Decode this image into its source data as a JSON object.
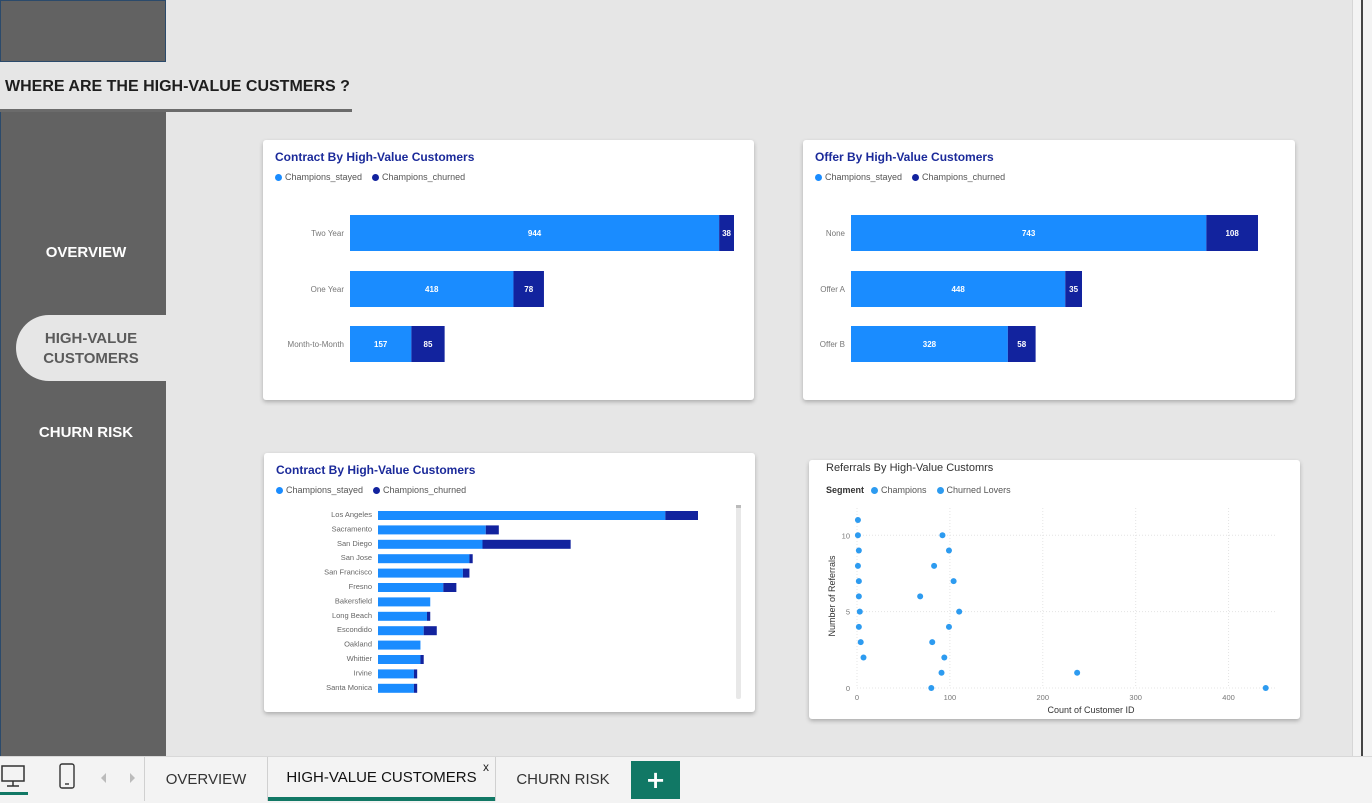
{
  "page": {
    "header": "WHERE ARE THE HIGH-VALUE CUSTMERS ?"
  },
  "nav": {
    "overview": "OVERVIEW",
    "high_value_line1": "HIGH-VALUE",
    "high_value_line2": "CUSTOMERS",
    "churn_risk": "CHURN RISK"
  },
  "colors": {
    "stayed": "#1a8cff",
    "churned": "#12239e",
    "accent": "#117865",
    "title": "#1b2a9a"
  },
  "legend": {
    "stayed": "Champions_stayed",
    "churned": "Champions_churned",
    "segment": "Segment",
    "champions": "Champions",
    "churned_lovers": "Churned Lovers"
  },
  "chart_data": [
    {
      "type": "bar",
      "orientation": "horizontal",
      "stacked": true,
      "title": "Contract By High-Value Customers",
      "categories": [
        "Two Year",
        "One Year",
        "Month-to-Month"
      ],
      "series": [
        {
          "name": "Champions_stayed",
          "values": [
            944,
            418,
            157
          ]
        },
        {
          "name": "Champions_churned",
          "values": [
            38,
            78,
            85
          ]
        }
      ],
      "data_labels": true,
      "legend": "top-left"
    },
    {
      "type": "bar",
      "orientation": "horizontal",
      "stacked": true,
      "title": "Offer By High-Value Customers",
      "categories": [
        "None",
        "Offer A",
        "Offer B"
      ],
      "series": [
        {
          "name": "Champions_stayed",
          "values": [
            743,
            448,
            328
          ]
        },
        {
          "name": "Champions_churned",
          "values": [
            108,
            35,
            58
          ]
        }
      ],
      "data_labels": true,
      "legend": "top-left"
    },
    {
      "type": "bar",
      "orientation": "horizontal",
      "stacked": true,
      "title": "Contract By High-Value Customers",
      "categories": [
        "Los Angeles",
        "Sacramento",
        "San Diego",
        "San Jose",
        "San Francisco",
        "Fresno",
        "Bakersfield",
        "Long Beach",
        "Escondido",
        "Oakland",
        "Whittier",
        "Irvine",
        "Santa Monica"
      ],
      "series": [
        {
          "name": "Champions_stayed",
          "values": [
            88,
            33,
            32,
            28,
            26,
            20,
            16,
            15,
            14,
            13,
            13,
            11,
            11
          ]
        },
        {
          "name": "Champions_churned",
          "values": [
            10,
            4,
            27,
            1,
            2,
            4,
            0,
            1,
            4,
            0,
            1,
            1,
            1
          ]
        }
      ],
      "data_labels": false,
      "legend": "top-left"
    },
    {
      "type": "scatter",
      "title": "Referrals By High-Value Customrs",
      "xlabel": "Count of Customer ID",
      "ylabel": "Number of Referrals",
      "xlim": [
        0,
        450
      ],
      "ylim": [
        0,
        11
      ],
      "xticks": [
        0,
        100,
        200,
        300,
        400
      ],
      "yticks": [
        0,
        5,
        10
      ],
      "grid": true,
      "series": [
        {
          "name": "Champions",
          "points": [
            [
              1,
              11
            ],
            [
              1,
              10
            ],
            [
              2,
              9
            ],
            [
              1,
              8
            ],
            [
              2,
              7
            ],
            [
              2,
              6
            ],
            [
              3,
              5
            ],
            [
              2,
              4
            ],
            [
              4,
              3
            ],
            [
              7,
              2
            ],
            [
              80,
              0
            ],
            [
              440,
              0
            ]
          ]
        },
        {
          "name": "Churned Lovers",
          "points": [
            [
              92,
              10
            ],
            [
              99,
              9
            ],
            [
              83,
              8
            ],
            [
              104,
              7
            ],
            [
              68,
              6
            ],
            [
              110,
              5
            ],
            [
              99,
              4
            ],
            [
              81,
              3
            ],
            [
              94,
              2
            ],
            [
              91,
              1
            ],
            [
              237,
              1
            ]
          ]
        }
      ],
      "legend": "top-left"
    }
  ],
  "tabs": {
    "overview": "OVERVIEW",
    "high_value": "HIGH-VALUE CUSTOMERS",
    "churn_risk": "CHURN RISK",
    "close": "x",
    "add": "+"
  }
}
